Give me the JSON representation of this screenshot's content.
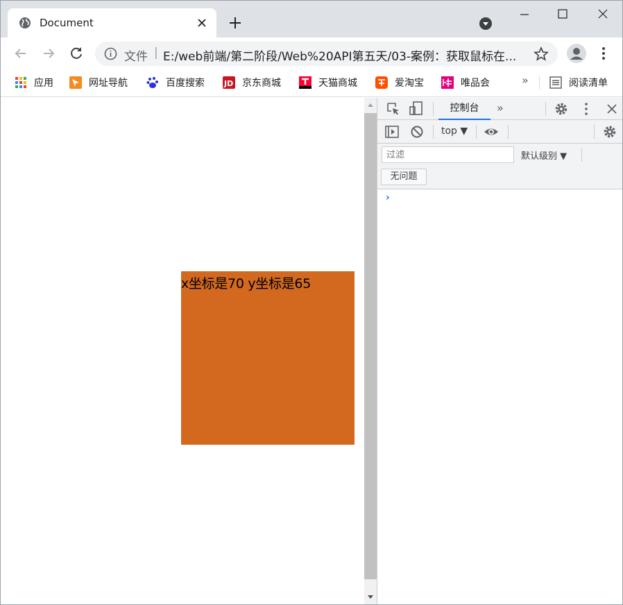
{
  "browser": {
    "tab_title": "Document",
    "address": {
      "scheme_label": "文件",
      "separator": "|",
      "url": "E:/web前端/第二阶段/Web%20API第五天/03-案例：获取鼠标在..."
    }
  },
  "bookmarks": [
    {
      "label": "应用",
      "icon": "apps-grid-icon",
      "color": "#ea4335"
    },
    {
      "label": "网址导航",
      "icon": "nav-arrow-icon",
      "color": "#f28b23"
    },
    {
      "label": "百度搜索",
      "icon": "baidu-paw-icon",
      "color": "#2932e1"
    },
    {
      "label": "京东商城",
      "icon": "jd-logo-icon",
      "color": "#c91623"
    },
    {
      "label": "天猫商城",
      "icon": "tmall-logo-icon",
      "color": "#ff0036"
    },
    {
      "label": "爱淘宝",
      "icon": "taobao-logo-icon",
      "color": "#ff5000"
    },
    {
      "label": "唯品会",
      "icon": "vip-logo-icon",
      "color": "#e4007f"
    },
    {
      "label": "阅读清单",
      "icon": "reading-list-icon",
      "color": "#5f6368"
    }
  ],
  "bookmarks_overflow": "»",
  "page": {
    "box_text": "x坐标是70 y坐标是65",
    "box_color": "#d2691e"
  },
  "devtools": {
    "console_tab": "控制台",
    "more_tabs": "»",
    "context": "top",
    "filter_placeholder": "过滤",
    "levels": "默认级别 ▼",
    "issues_button": "无问题",
    "prompt": "›"
  },
  "colors": {
    "tabstrip_bg": "#dee1e6",
    "omnibox_bg": "#f1f3f4",
    "accent_blue": "#1a73e8"
  }
}
